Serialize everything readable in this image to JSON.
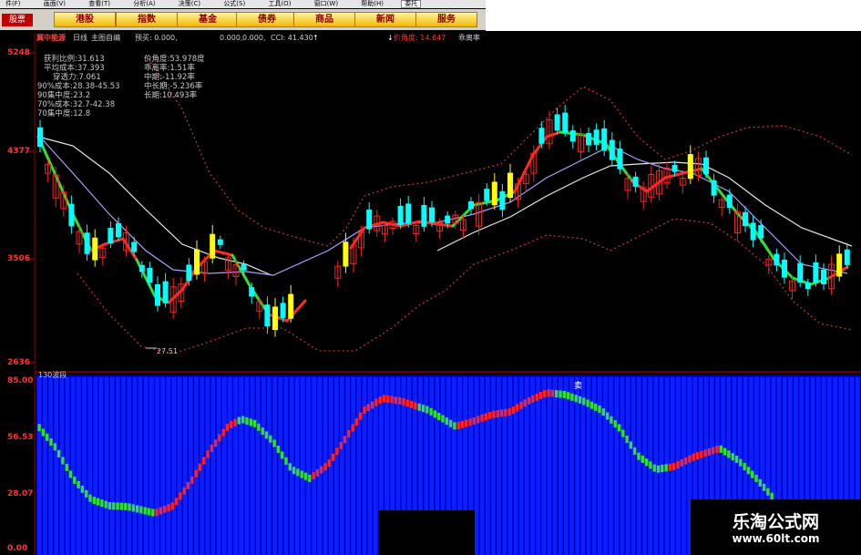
{
  "menu": {
    "items": [
      "件(F)",
      "画面(V)",
      "查看(T)",
      "分析(A)",
      "决策(C)",
      "公式(S)",
      "工具(O)",
      "窗口(W)",
      "帮助(H)",
      "委托"
    ]
  },
  "toolbar": {
    "left_tab": "股票",
    "buttons": [
      "港股",
      "指数",
      "基金",
      "债券",
      "商品",
      "新闻",
      "服务"
    ]
  },
  "info_bar": {
    "window_title": "冀中能源",
    "period": "日线",
    "mode": "主图自编",
    "forecast_label": "预买: 0.000,",
    "v1": "0.000,",
    "v2": "0.000,",
    "cci": "CCI: 41.430",
    "cci_arrow": "↑",
    "angle": "价角度: 14.647",
    "angle_arrow": "↓",
    "stickiness": "乖离率"
  },
  "stats_left": [
    {
      "label": "获利比例",
      "value": "31.613"
    },
    {
      "label": "平均成本",
      "value": "37.393"
    },
    {
      "label": "穿透力",
      "value": "7.061"
    },
    {
      "label": "90%成本",
      "value": "28.38-45.53"
    },
    {
      "label": "90集中度",
      "value": "23.2"
    },
    {
      "label": "70%成本",
      "value": "32.7-42.38"
    },
    {
      "label": "70集中度",
      "value": "12.8"
    }
  ],
  "stats_right": [
    {
      "label": "价角度",
      "value": "53.978度"
    },
    {
      "label": "乖离率",
      "value": "1.51率"
    },
    {
      "label": "中期",
      "value": "-11.92率"
    },
    {
      "label": "中长期",
      "value": "-5.236率"
    },
    {
      "label": "长期",
      "value": "10.493率"
    }
  ],
  "price_axis": {
    "ticks": [
      "5248",
      "4377",
      "3506",
      "2636"
    ],
    "low_label": "27.51"
  },
  "indicator": {
    "name": "130波段",
    "ticks": [
      "85.00",
      "56.53",
      "28.07",
      "0.00"
    ],
    "buy_marker": "卖"
  },
  "watermark": {
    "title": "乐淘公式网",
    "url": "www.60lt.com"
  },
  "colors": {
    "up": "#ff2020",
    "down": "#00ffff",
    "flat_yellow": "#ffff00",
    "ma_green": "#30e030",
    "ma_red": "#ff2a2a",
    "ma_white": "#e8e8e8",
    "ma_purple": "#b0a0ff",
    "band": "#c03030",
    "indicator_bg": "#0000c8"
  }
}
